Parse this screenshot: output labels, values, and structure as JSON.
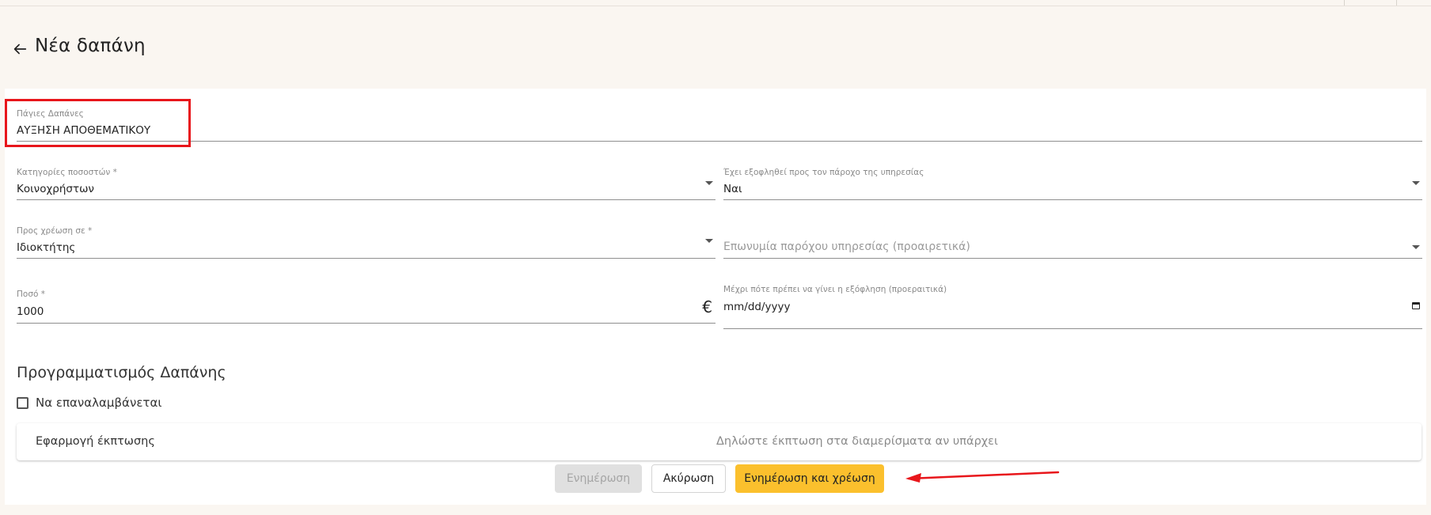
{
  "page": {
    "title": "Νέα δαπάνη"
  },
  "form": {
    "fixed_expenses": {
      "label": "Πάγιες Δαπάνες",
      "value": "ΑΥΞΗΣΗ ΑΠΟΘΕΜΑΤΙΚΟΥ"
    },
    "percentage_category": {
      "label": "Κατηγορίες ποσοστών *",
      "value": "Κοινοχρήστων"
    },
    "paid_to_provider": {
      "label": "Έχει εξοφληθεί προς τον πάροχο της υπηρεσίας",
      "value": "Ναι"
    },
    "charge_to": {
      "label": "Προς χρέωση σε *",
      "value": "Ιδιοκτήτης"
    },
    "provider_name": {
      "placeholder": "Επωνυμία παρόχου υπηρεσίας (προαιρετικά)"
    },
    "amount": {
      "label": "Ποσό *",
      "value": "1000",
      "currency": "€"
    },
    "due_date": {
      "label": "Μέχρι πότε πρέπει να γίνει η εξόφληση (προεραιτικά)",
      "value": "mm/dd/yyyy"
    }
  },
  "scheduling": {
    "title": "Προγραμματισμός Δαπάνης",
    "repeat_label": "Να επαναλαμβάνεται",
    "repeat_checked": false
  },
  "discount": {
    "label": "Εφαρμογή έκπτωσης",
    "hint": "Δηλώστε έκπτωση στα διαμερίσματα αν υπάρχει"
  },
  "actions": {
    "update_label": "Ενημέρωση",
    "cancel_label": "Ακύρωση",
    "update_charge_label": "Ενημέρωση και χρέωση"
  },
  "colors": {
    "accent": "#fbc02d",
    "annotation": "#e8161b",
    "background": "#faf6f1"
  }
}
